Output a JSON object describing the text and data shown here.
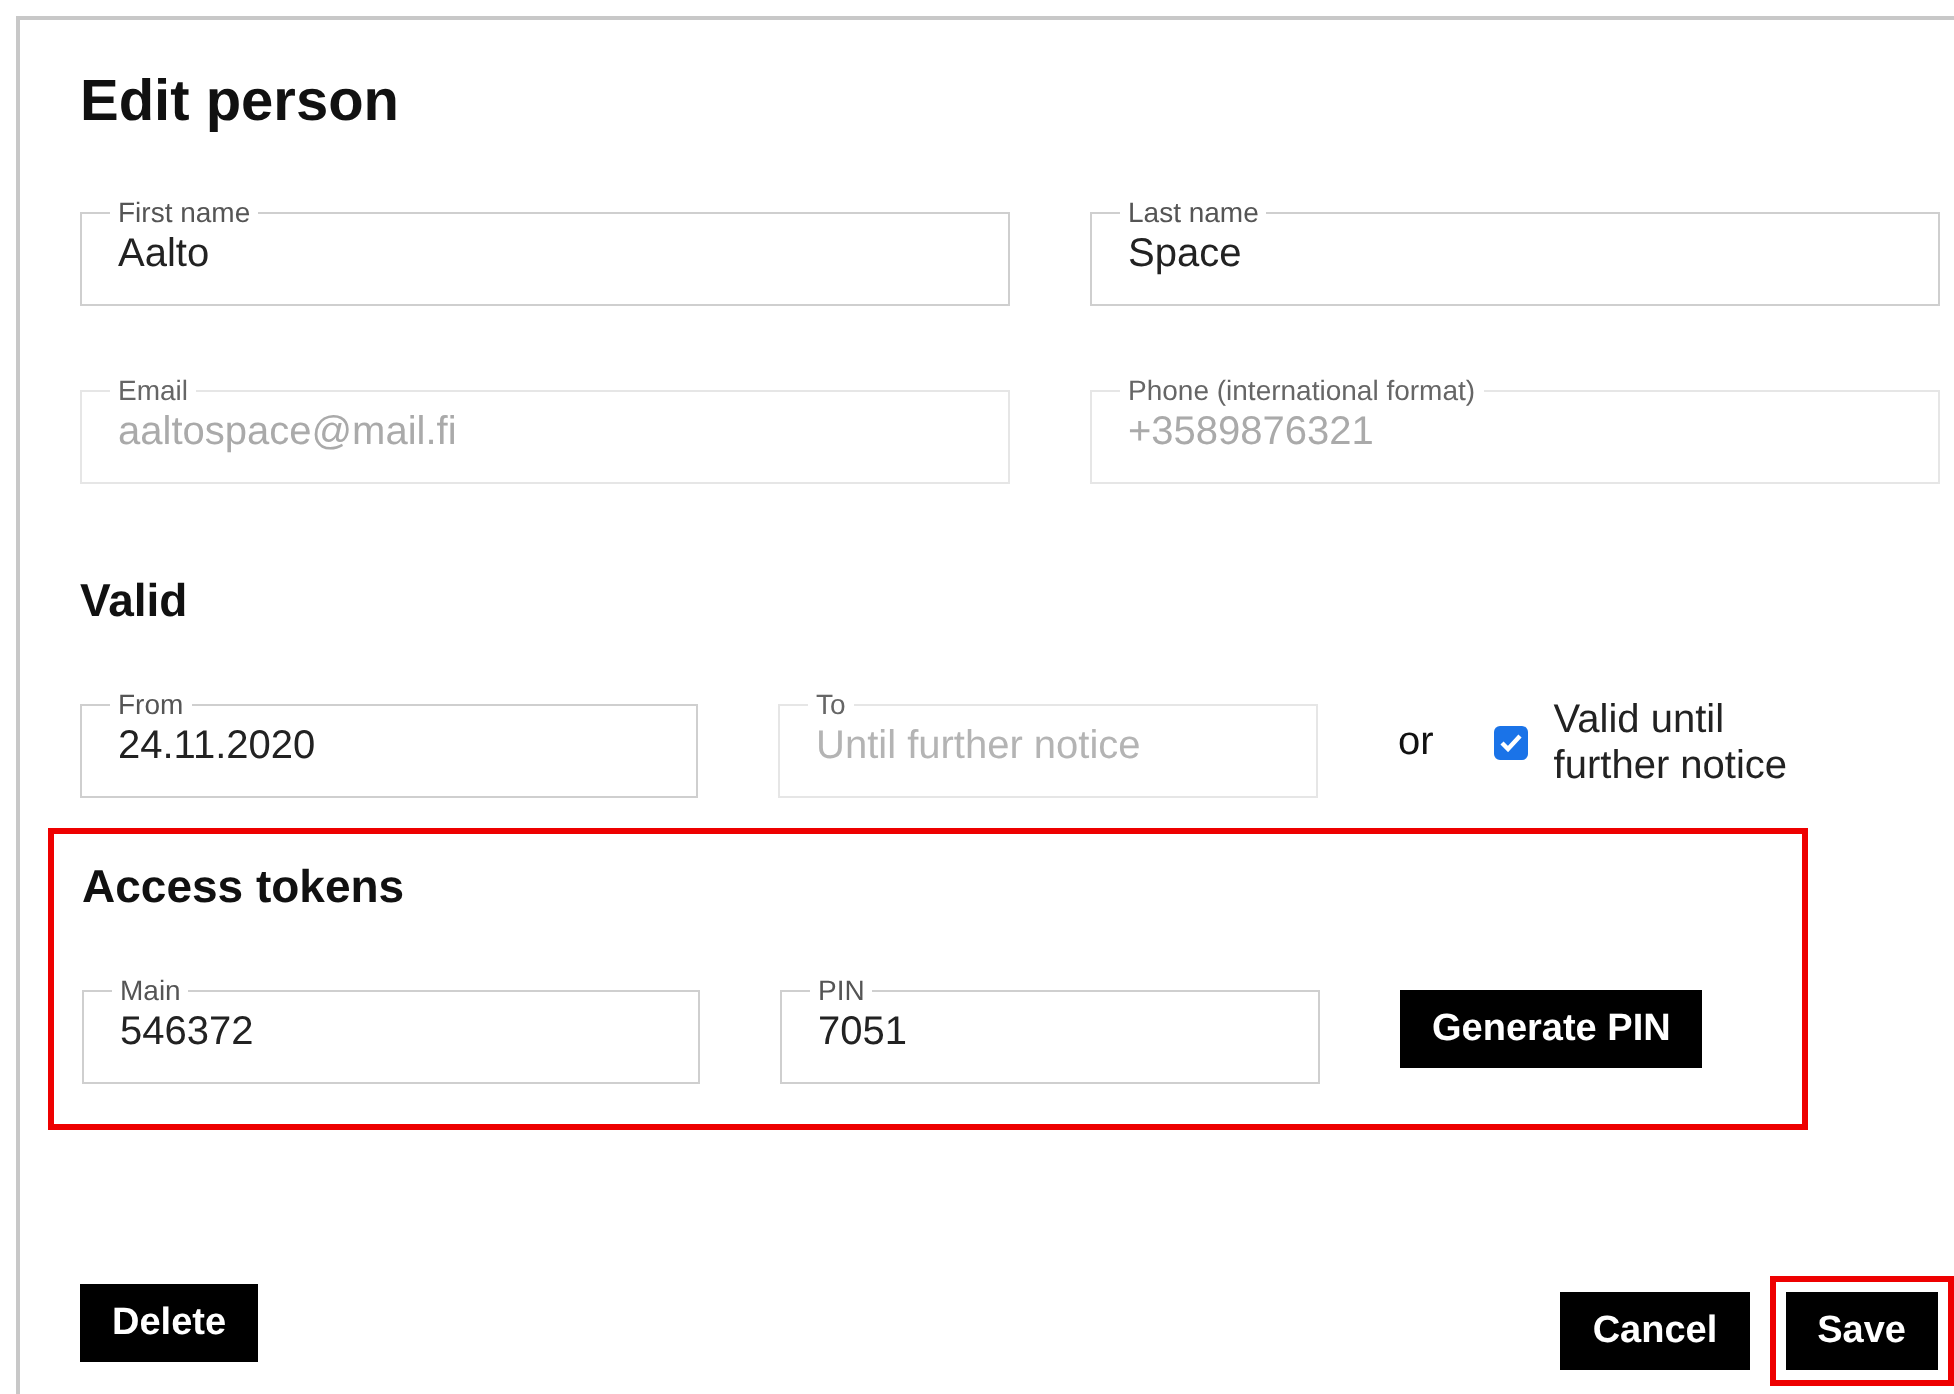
{
  "dialog": {
    "title": "Edit person"
  },
  "person_fields": [
    {
      "label": "First name",
      "value": "Aalto",
      "disabled": false
    },
    {
      "label": "Last name",
      "value": "Space",
      "disabled": false
    },
    {
      "label": "Email",
      "value": "aaltospace@mail.fi",
      "disabled": true
    },
    {
      "label": "Phone (international format)",
      "value": "+3589876321",
      "disabled": true
    }
  ],
  "valid": {
    "heading": "Valid",
    "from": {
      "label": "From",
      "value": "24.11.2020",
      "disabled": false
    },
    "to": {
      "label": "To",
      "placeholder": "Until further notice",
      "disabled": true
    },
    "separator": "or",
    "until_further_notice": {
      "label": "Valid until further notice",
      "checked": true
    }
  },
  "access_tokens": {
    "heading": "Access tokens",
    "highlighted": true,
    "fields": [
      {
        "label": "Main",
        "value": "546372",
        "disabled": false
      },
      {
        "label": "PIN",
        "value": "7051",
        "disabled": false
      }
    ],
    "generate_button": "Generate PIN"
  },
  "delete_button": {
    "label": "Delete"
  },
  "cancel_button": {
    "label": "Cancel",
    "highlighted": false
  },
  "save_button": {
    "label": "Save",
    "highlighted": true
  }
}
